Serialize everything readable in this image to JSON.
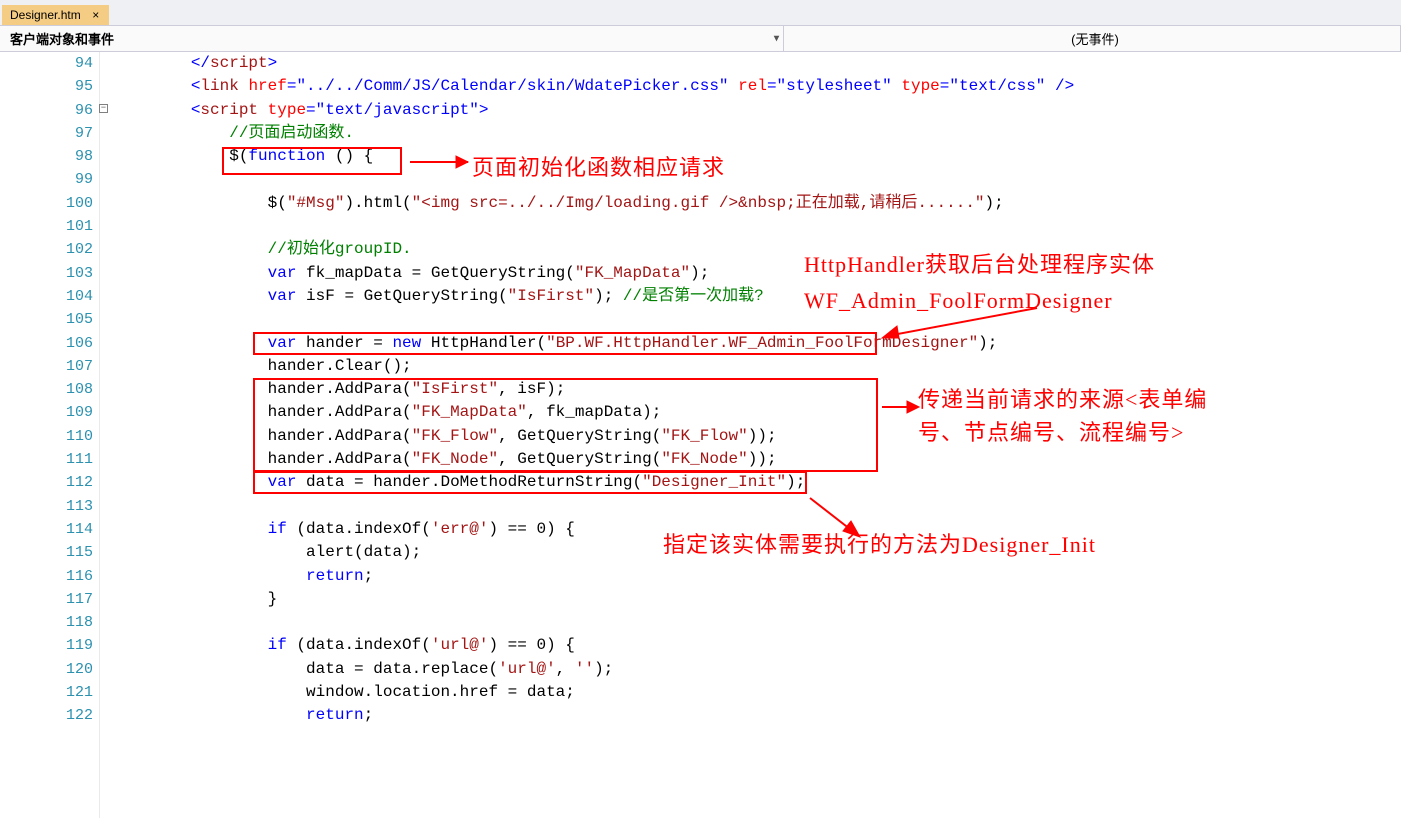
{
  "tab": {
    "title": "Designer.htm",
    "close": "×"
  },
  "dropdowns": {
    "left": "客户端对象和事件",
    "right": "(无事件)"
  },
  "lineStart": 94,
  "lineEnd": 122,
  "code": {
    "l94": "        </script>",
    "l95": "        <link href=\"../../Comm/JS/Calendar/skin/WdatePicker.css\" rel=\"stylesheet\" type=\"text/css\" />",
    "l96": "        <script type=\"text/javascript\">",
    "l97": "            //页面启动函数.",
    "l98": "            $(function () {",
    "l99": "",
    "l100": "                $(\"#Msg\").html(\"<img src=../../Img/loading.gif />&nbsp;正在加载,请稍后......\");",
    "l101": "",
    "l102": "                //初始化groupID.",
    "l103": "                var fk_mapData = GetQueryString(\"FK_MapData\"); ",
    "l104": "                var isF = GetQueryString(\"IsFirst\"); //是否第一次加载?",
    "l105": "",
    "l106": "                var hander = new HttpHandler(\"BP.WF.HttpHandler.WF_Admin_FoolFormDesigner\");",
    "l107": "                hander.Clear();",
    "l108": "                hander.AddPara(\"IsFirst\", isF);",
    "l109": "                hander.AddPara(\"FK_MapData\", fk_mapData);",
    "l110": "                hander.AddPara(\"FK_Flow\", GetQueryString(\"FK_Flow\"));",
    "l111": "                hander.AddPara(\"FK_Node\", GetQueryString(\"FK_Node\"));",
    "l112": "                var data = hander.DoMethodReturnString(\"Designer_Init\");",
    "l113": "",
    "l114": "                if (data.indexOf('err@') == 0) {",
    "l115": "                    alert(data);",
    "l116": "                    return;",
    "l117": "                }",
    "l118": "",
    "l119": "                if (data.indexOf('url@') == 0) {",
    "l120": "                    data = data.replace('url@', '');",
    "l121": "                    window.location.href = data;",
    "l122": "                    return;"
  },
  "annotations": {
    "a1": "页面初始化函数相应请求",
    "a2": "HttpHandler获取后台处理程序实体",
    "a3": "WF_Admin_FoolFormDesigner",
    "a4": "传递当前请求的来源<表单编",
    "a4b": "号、节点编号、流程编号>",
    "a5": "指定该实体需要执行的方法为Designer_Init"
  }
}
